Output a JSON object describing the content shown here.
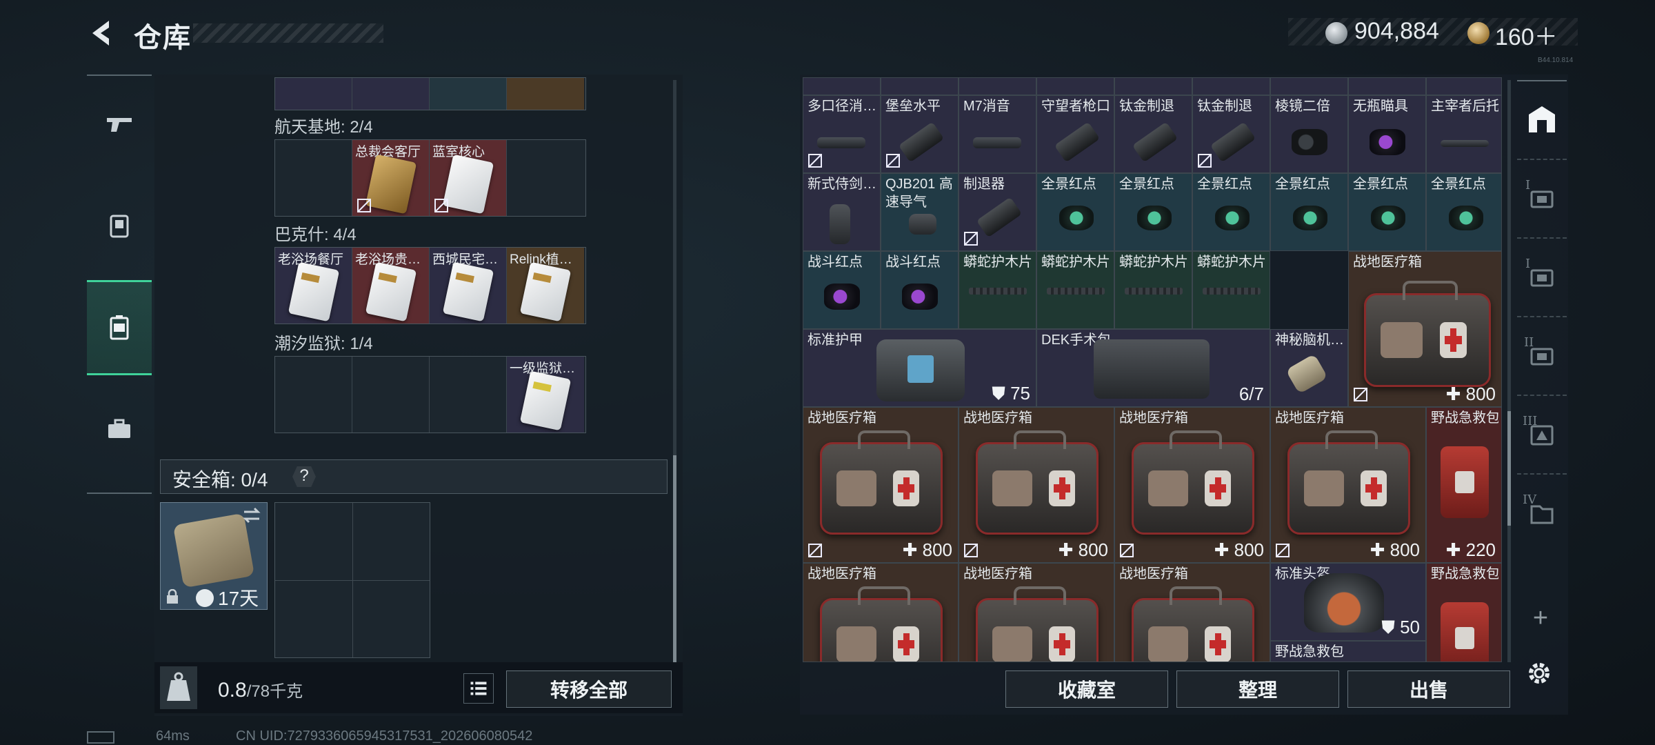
{
  "header": {
    "title": "仓库",
    "silver_amount": "904,884",
    "gold_amount": "160＋",
    "version_tiny": "B44.10.814"
  },
  "left_nav": {
    "items": [
      {
        "name": "weapons",
        "active": false
      },
      {
        "name": "keycard-case",
        "active": false
      },
      {
        "name": "container",
        "active": true
      },
      {
        "name": "toolbox",
        "active": false
      }
    ]
  },
  "left_panel": {
    "sections": [
      {
        "label": "航天基地: 2/4",
        "cells": [
          {
            "label": "",
            "color": "",
            "card": false
          },
          {
            "label": "总裁会客厅",
            "color": "red",
            "card": true,
            "gold": true
          },
          {
            "label": "蓝室核心",
            "color": "red",
            "card": true,
            "gold": false
          },
          {
            "label": "",
            "color": "",
            "card": false
          }
        ]
      },
      {
        "label": "巴克什: 4/4",
        "cells": [
          {
            "label": "老浴场餐厅",
            "color": "navy",
            "card": true
          },
          {
            "label": "老浴场贵…",
            "color": "red",
            "card": true
          },
          {
            "label": "西城民宅…",
            "color": "navy",
            "card": true
          },
          {
            "label": "Relink植…",
            "color": "gold",
            "card": true
          }
        ]
      },
      {
        "label": "潮汐监狱: 1/4",
        "cells": [
          {
            "label": "",
            "color": "",
            "card": false
          },
          {
            "label": "",
            "color": "",
            "card": false
          },
          {
            "label": "",
            "color": "",
            "card": false
          },
          {
            "label": "一级监狱…",
            "color": "navy",
            "card": true
          }
        ]
      }
    ],
    "safe_box": {
      "label": "安全箱: 0/4",
      "help": "?",
      "days": "17天"
    },
    "weight": {
      "value": "0.8",
      "max": "/78千克"
    },
    "transfer_all": "转移全部"
  },
  "status": {
    "ping": "64ms",
    "uid": "CN UID:7279336065945317531_202606080542"
  },
  "warehouse": {
    "row1": [
      {
        "label": "多口径消…",
        "bg": "navy",
        "item": "tube"
      },
      {
        "label": "堡垒水平",
        "bg": "navy",
        "item": "comp"
      },
      {
        "label": "M7消音",
        "bg": "navy",
        "item": "tube"
      },
      {
        "label": "守望者枪口",
        "bg": "navy",
        "item": "comp"
      },
      {
        "label": "钛金制退",
        "bg": "navy",
        "item": "comp"
      },
      {
        "label": "钛金制退",
        "bg": "navy",
        "item": "comp"
      },
      {
        "label": "棱镜二倍",
        "bg": "navy",
        "item": "scope"
      },
      {
        "label": "无瓶瞄具",
        "bg": "navy",
        "item": "red-dot"
      },
      {
        "label": "主宰者后托",
        "bg": "navy",
        "item": "stock"
      }
    ],
    "row2": [
      {
        "label": "新式侍剑…",
        "bg": "navy",
        "item": "grip"
      },
      {
        "label": "QJB201 高速导气",
        "bg": "teal",
        "item": "block"
      },
      {
        "label": "制退器",
        "bg": "navy",
        "item": "comp"
      },
      {
        "label": "全景红点",
        "bg": "teal",
        "item": "green-scope"
      },
      {
        "label": "全景红点",
        "bg": "teal",
        "item": "green-scope"
      },
      {
        "label": "全景红点",
        "bg": "teal",
        "item": "green-scope"
      },
      {
        "label": "全景红点",
        "bg": "teal",
        "item": "green-scope"
      },
      {
        "label": "全景红点",
        "bg": "teal",
        "item": "green-scope"
      },
      {
        "label": "全景红点",
        "bg": "teal",
        "item": "green-scope"
      }
    ],
    "row3": [
      {
        "label": "战斗红点",
        "bg": "teal",
        "item": "red-scope"
      },
      {
        "label": "战斗红点",
        "bg": "teal",
        "item": "red-scope"
      },
      {
        "label": "蟒蛇护木片",
        "bg": "green",
        "item": "rail"
      },
      {
        "label": "蟒蛇护木片",
        "bg": "green",
        "item": "rail"
      },
      {
        "label": "蟒蛇护木片",
        "bg": "green",
        "item": "rail"
      },
      {
        "label": "蟒蛇护木片",
        "bg": "green",
        "item": "rail"
      }
    ],
    "big_kit_top": {
      "label": "战地医疗箱",
      "stat": "800"
    },
    "row4": [
      {
        "label": "标准护甲",
        "stat": "75"
      },
      {
        "label": "DEK手术包",
        "stat": "6/7"
      },
      {
        "label": "神秘脑机…"
      }
    ],
    "row5": [
      {
        "label": "战地医疗箱",
        "stat": "800"
      },
      {
        "label": "战地医疗箱",
        "stat": "800"
      },
      {
        "label": "战地医疗箱",
        "stat": "800"
      },
      {
        "label": "战地医疗箱",
        "stat": "800"
      },
      {
        "label": "野战急救包",
        "stat": "220"
      }
    ],
    "row6": [
      {
        "label": "战地医疗箱"
      },
      {
        "label": "战地医疗箱"
      },
      {
        "label": "战地医疗箱"
      },
      {
        "label": "标准头盔",
        "stat": "50"
      },
      {
        "label": "野战急救包"
      }
    ],
    "row6_extra_label": "野战急救包"
  },
  "right_buttons": {
    "collection": "收藏室",
    "organize": "整理",
    "sell": "出售"
  },
  "right_tabs": {
    "tab_labels": [
      "I",
      "I",
      "II",
      "III",
      "IV"
    ],
    "plus": "+"
  }
}
